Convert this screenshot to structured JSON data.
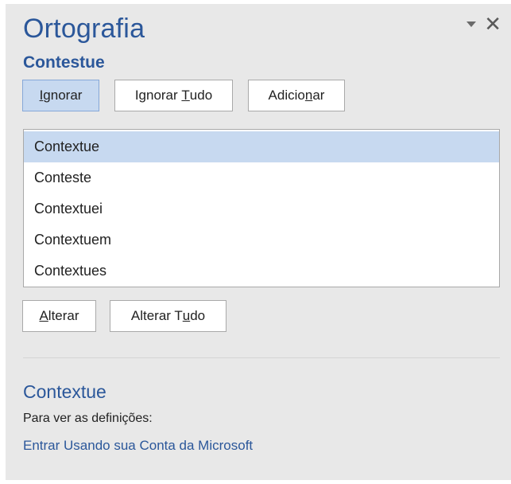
{
  "pane": {
    "title": "Ortografia",
    "misspelled_word": "Contestue"
  },
  "actions": {
    "ignore": {
      "pre": "",
      "key": "I",
      "post": "gnorar"
    },
    "ignore_all": {
      "pre": "Ignorar ",
      "key": "T",
      "post": "udo"
    },
    "add": {
      "pre": "Adicio",
      "key": "n",
      "post": "ar"
    }
  },
  "suggestions": [
    {
      "label": "Contextue",
      "selected": true
    },
    {
      "label": "Conteste",
      "selected": false
    },
    {
      "label": "Contextuei",
      "selected": false
    },
    {
      "label": "Contextuem",
      "selected": false
    },
    {
      "label": "Contextues",
      "selected": false
    }
  ],
  "change": {
    "change": {
      "pre": "",
      "key": "A",
      "post": "lterar"
    },
    "change_all": {
      "pre": "Alterar T",
      "key": "u",
      "post": "do"
    }
  },
  "definition": {
    "word": "Contextue",
    "label": "Para ver as definições:",
    "link": "Entrar Usando sua Conta da Microsoft"
  },
  "colors": {
    "accent": "#2b579a",
    "selected_bg": "#c7d9f0",
    "pane_bg": "#e8e8e8"
  },
  "icons": [
    "pane-options-icon",
    "close-icon"
  ]
}
